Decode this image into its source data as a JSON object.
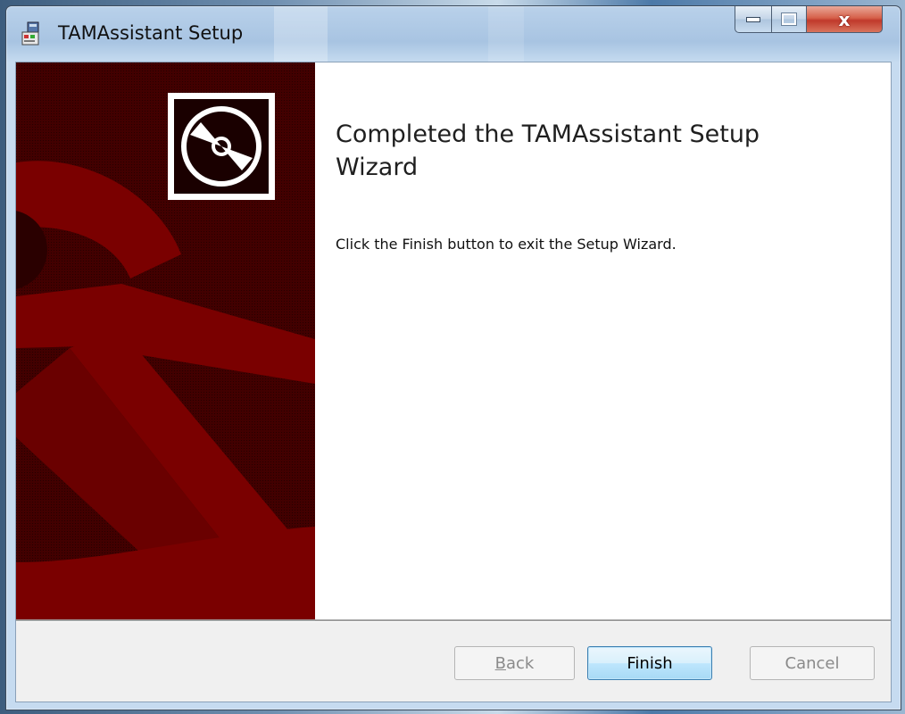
{
  "window": {
    "title": "TAMAssistant Setup",
    "controls": {
      "minimize": "minimize",
      "maximize": "maximize",
      "close": "x"
    }
  },
  "banner": {
    "background": "#420000",
    "accent": "#7a0000",
    "icon": "cd-disc-icon"
  },
  "main": {
    "heading": "Completed the TAMAssistant Setup Wizard",
    "message": "Click the Finish button to exit the Setup Wizard."
  },
  "footer": {
    "back": {
      "mnemonic": "B",
      "rest": "ack",
      "enabled": false
    },
    "finish": {
      "label": "Finish",
      "enabled": true,
      "default": true
    },
    "cancel": {
      "label": "Cancel",
      "enabled": false
    }
  },
  "colors": {
    "default_button_border": "#3c7fb1",
    "close_button": "#c0392b",
    "disabled_text": "#8a8a8a"
  }
}
